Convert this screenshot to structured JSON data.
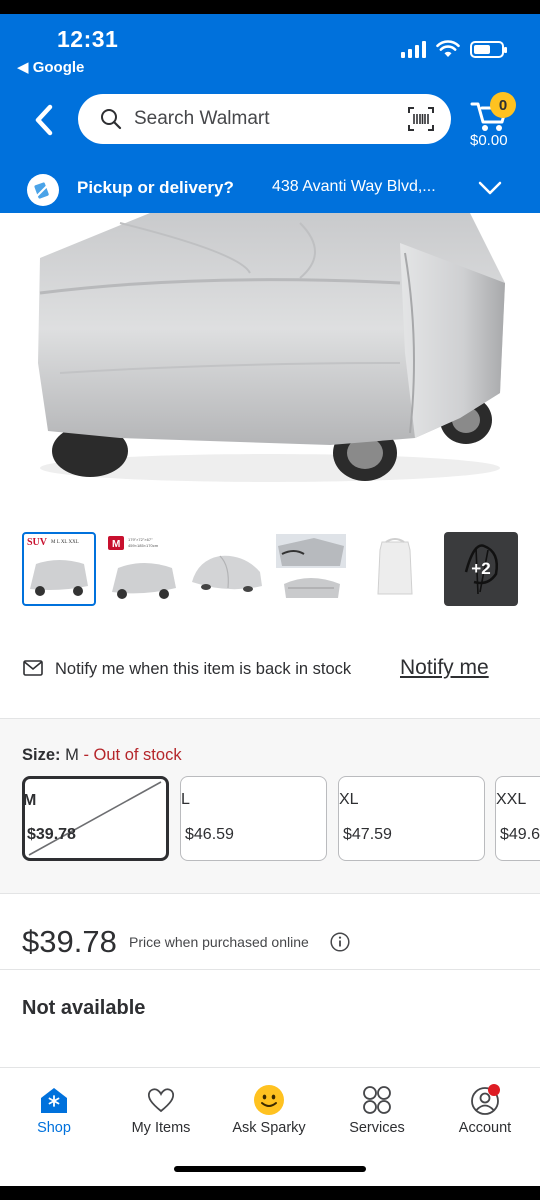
{
  "status_bar": {
    "time": "12:31",
    "back_app": "◀ Google",
    "icons": [
      "signal-icon",
      "wifi-icon",
      "battery-icon"
    ]
  },
  "header": {
    "search_placeholder": "Search Walmart",
    "cart_count": "0",
    "cart_total": "$0.00",
    "pickup_label": "Pickup or delivery?",
    "pickup_address": "438 Avanti Way Blvd,...",
    "brand_color": "#0071dc",
    "badge_color": "#ffc220"
  },
  "gallery": {
    "thumbnails": [
      {
        "name": "suv-sizes-thumbnail"
      },
      {
        "name": "size-chart-thumbnail"
      },
      {
        "name": "covered-car-thumbnail"
      },
      {
        "name": "detail-thumbnail"
      },
      {
        "name": "bag-thumbnail"
      }
    ],
    "more_count": "+2"
  },
  "notify": {
    "text": "Notify me when this item is back in stock",
    "link": "Notify me"
  },
  "size_selector": {
    "title": "Size:",
    "selected_value": "M",
    "separator": " - ",
    "status": "Out of stock",
    "options": [
      {
        "label": "M",
        "price": "$39.78",
        "selected": true,
        "out_of_stock": true
      },
      {
        "label": "L",
        "price": "$46.59",
        "selected": false
      },
      {
        "label": "XL",
        "price": "$47.59",
        "selected": false
      },
      {
        "label": "XXL",
        "price": "$49.6",
        "selected": false
      }
    ]
  },
  "pricing": {
    "price": "$39.78",
    "note": "Price when purchased online"
  },
  "availability": "Not available",
  "tab_bar": {
    "tabs": [
      {
        "label": "Shop",
        "icon": "shop-icon",
        "active": true
      },
      {
        "label": "My Items",
        "icon": "heart-icon",
        "active": false
      },
      {
        "label": "Ask Sparky",
        "icon": "sparky-icon",
        "active": false
      },
      {
        "label": "Services",
        "icon": "services-icon",
        "active": false
      },
      {
        "label": "Account",
        "icon": "account-icon",
        "active": false
      }
    ]
  }
}
